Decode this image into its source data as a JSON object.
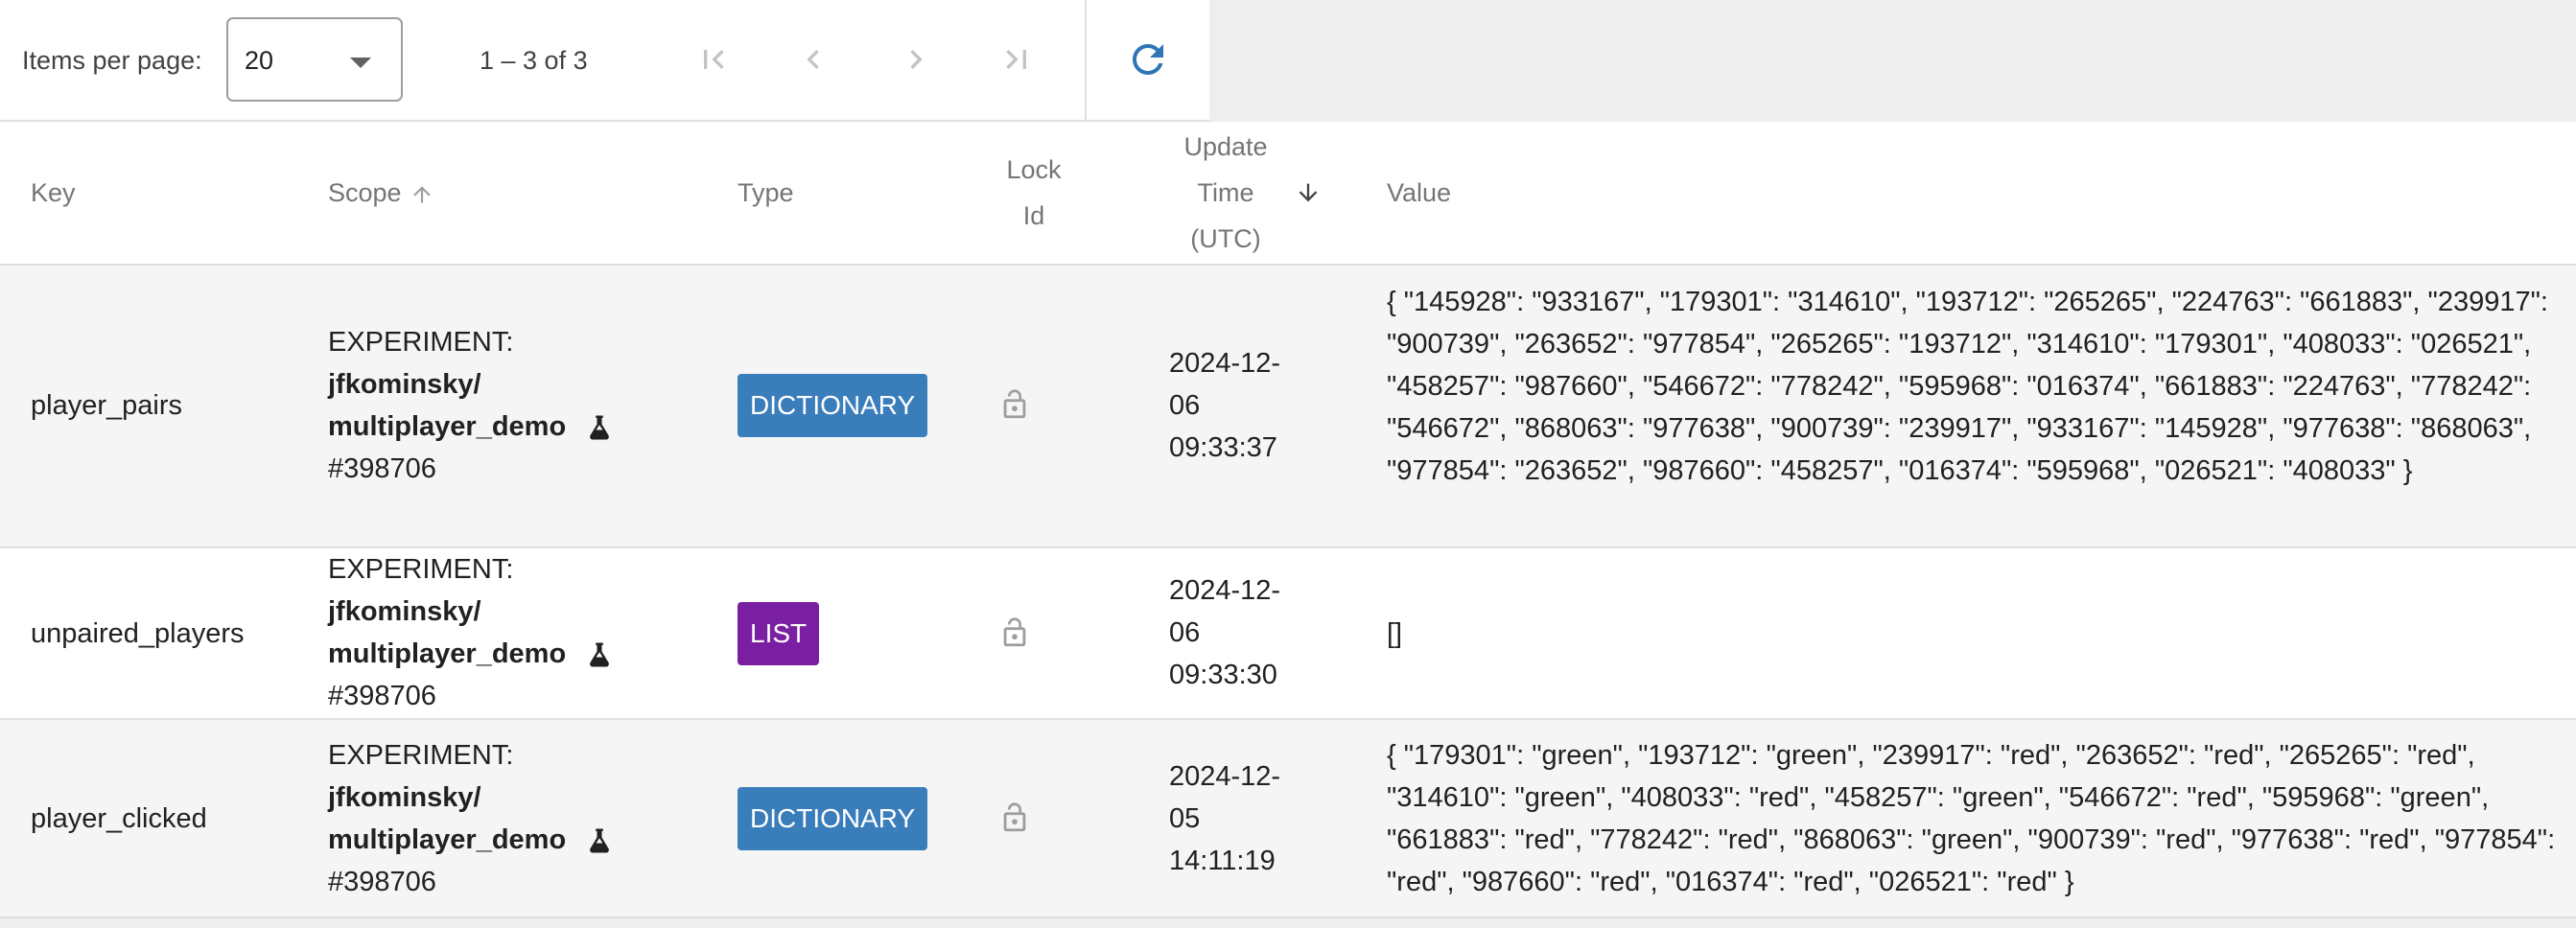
{
  "pagination": {
    "items_per_page_label": "Items per page:",
    "items_per_page_value": "20",
    "range_label": "1 – 3 of 3"
  },
  "icons": {
    "first_page": "first-page-icon",
    "prev_page": "chevron-left-icon",
    "next_page": "chevron-right-icon",
    "last_page": "last-page-icon",
    "refresh": "refresh-icon",
    "lock": "lock-open-icon",
    "flask": "flask-icon",
    "sort_asc": "arrow-up-icon",
    "sort_desc": "arrow-down-icon"
  },
  "colors": {
    "dictionary_badge": "#3a7dbb",
    "list_badge": "#7b1fa2",
    "refresh": "#2e75b6"
  },
  "table": {
    "headers": {
      "key": "Key",
      "scope": "Scope",
      "type": "Type",
      "lock_line1": "Lock",
      "lock_line2": "Id",
      "update_line1": "Update",
      "update_line2": "Time",
      "update_line3": "(UTC)",
      "value": "Value"
    },
    "rows": [
      {
        "key": "player_pairs",
        "scope_prefix": "EXPERIMENT:",
        "scope_owner": "jfkominsky/",
        "scope_name": "multiplayer_demo",
        "scope_id": "#398706",
        "type": "DICTIONARY",
        "time_line1": "2024-12-",
        "time_line2": "06",
        "time_line3": "09:33:37",
        "value": "{ \"145928\": \"933167\", \"179301\": \"314610\", \"193712\": \"265265\", \"224763\": \"661883\", \"239917\": \"900739\", \"263652\": \"977854\", \"265265\": \"193712\", \"314610\": \"179301\", \"408033\": \"026521\", \"458257\": \"987660\", \"546672\": \"778242\", \"595968\": \"016374\", \"661883\": \"224763\", \"778242\": \"546672\", \"868063\": \"977638\", \"900739\": \"239917\", \"933167\": \"145928\", \"977638\": \"868063\", \"977854\": \"263652\", \"987660\": \"458257\", \"016374\": \"595968\", \"026521\": \"408033\" }"
      },
      {
        "key": "unpaired_players",
        "scope_prefix": "EXPERIMENT:",
        "scope_owner": "jfkominsky/",
        "scope_name": "multiplayer_demo",
        "scope_id": "#398706",
        "type": "LIST",
        "time_line1": "2024-12-",
        "time_line2": "06",
        "time_line3": "09:33:30",
        "value": "[]"
      },
      {
        "key": "player_clicked",
        "scope_prefix": "EXPERIMENT:",
        "scope_owner": "jfkominsky/",
        "scope_name": "multiplayer_demo",
        "scope_id": "#398706",
        "type": "DICTIONARY",
        "time_line1": "2024-12-",
        "time_line2": "05",
        "time_line3": "14:11:19",
        "value": "{ \"179301\": \"green\", \"193712\": \"green\", \"239917\": \"red\", \"263652\": \"red\", \"265265\": \"red\", \"314610\": \"green\", \"408033\": \"red\", \"458257\": \"green\", \"546672\": \"red\", \"595968\": \"green\", \"661883\": \"red\", \"778242\": \"red\", \"868063\": \"green\", \"900739\": \"red\", \"977638\": \"red\", \"977854\": \"red\", \"987660\": \"red\", \"016374\": \"red\", \"026521\": \"red\" }"
      }
    ]
  }
}
